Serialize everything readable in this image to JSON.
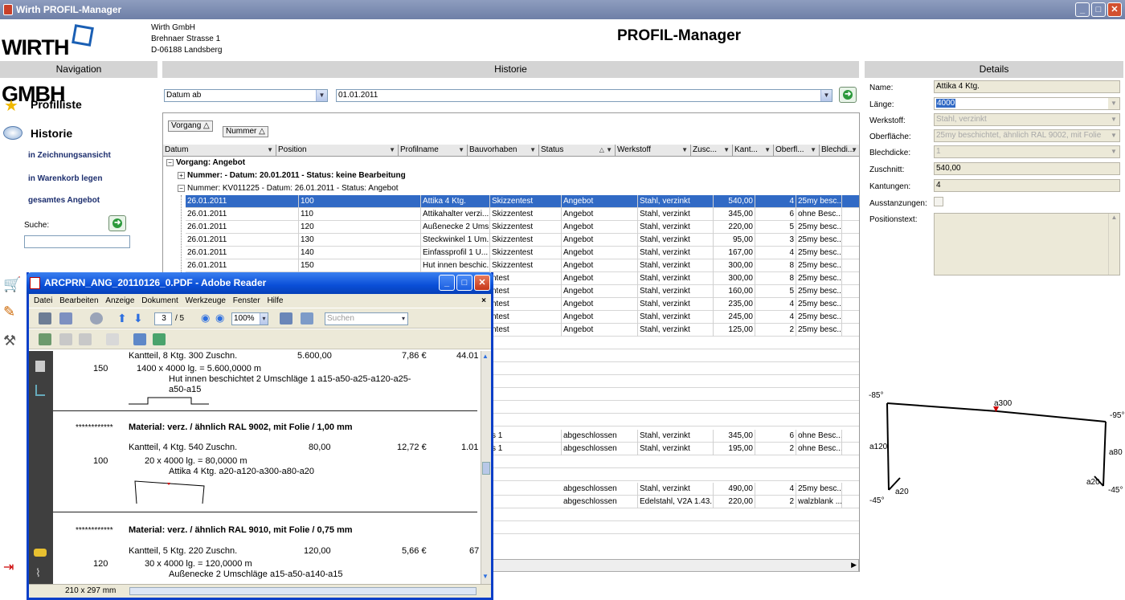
{
  "window": {
    "title": "Wirth PROFIL-Manager"
  },
  "header": {
    "logo_left": "WIRTH",
    "logo_right": "GMBH",
    "company_name": "Wirth GmbH",
    "street": "Brehnaer Strasse 1",
    "city": "D-06188 Landsberg",
    "app_title": "PROFIL-Manager"
  },
  "navigation": {
    "title": "Navigation",
    "profilliste": "Profilliste",
    "historie": "Historie",
    "zeichnung": "in Zeichnungsansicht",
    "warenkorb": "in Warenkorb legen",
    "angebot": "gesamtes Angebot",
    "suche_label": "Suche:",
    "suche_value": ""
  },
  "historie": {
    "title": "Historie",
    "filter_field": "Datum ab",
    "filter_date": "01.01.2011",
    "group_chips": [
      "Vorgang △",
      "Nummer △"
    ],
    "columns": [
      "Datum",
      "Position",
      "Profilname",
      "Bauvorhaben",
      "Status",
      "Werkstoff",
      "Zusc...",
      "Kant...",
      "Oberfl...",
      "Blechdi..."
    ],
    "group1": "Vorgang: Angebot",
    "sub1": "Nummer:  - Datum: 20.01.2011 - Status: keine Bearbeitung",
    "sub2": "Nummer: KV011225 - Datum: 26.01.2011 - Status: Angebot",
    "rows": [
      {
        "datum": "26.01.2011",
        "position": "100",
        "profil": "Attika 4 Ktg.",
        "bau": "Skizzentest",
        "status": "Angebot",
        "werk": "Stahl, verzinkt",
        "zus": "540,00",
        "kant": "4",
        "ober": "25my besc...",
        "blech": "1,0"
      },
      {
        "datum": "26.01.2011",
        "position": "110",
        "profil": "Attikahalter verzi...",
        "bau": "Skizzentest",
        "status": "Angebot",
        "werk": "Stahl, verzinkt",
        "zus": "345,00",
        "kant": "6",
        "ober": "ohne Besc...",
        "blech": "3,0"
      },
      {
        "datum": "26.01.2011",
        "position": "120",
        "profil": "Außenecke 2 Ums...",
        "bau": "Skizzentest",
        "status": "Angebot",
        "werk": "Stahl, verzinkt",
        "zus": "220,00",
        "kant": "5",
        "ober": "25my besc...",
        "blech": "0,7"
      },
      {
        "datum": "26.01.2011",
        "position": "130",
        "profil": "Steckwinkel 1 Um...",
        "bau": "Skizzentest",
        "status": "Angebot",
        "werk": "Stahl, verzinkt",
        "zus": "95,00",
        "kant": "3",
        "ober": "25my besc...",
        "blech": "0,7"
      },
      {
        "datum": "26.01.2011",
        "position": "140",
        "profil": "Einfassprofil 1 U...",
        "bau": "Skizzentest",
        "status": "Angebot",
        "werk": "Stahl, verzinkt",
        "zus": "167,00",
        "kant": "4",
        "ober": "25my besc...",
        "blech": "0,7"
      },
      {
        "datum": "26.01.2011",
        "position": "150",
        "profil": "Hut innen beschic...",
        "bau": "Skizzentest",
        "status": "Angebot",
        "werk": "Stahl, verzinkt",
        "zus": "300,00",
        "kant": "8",
        "ober": "25my besc...",
        "blech": "0,7"
      },
      {
        "datum": "",
        "position": "",
        "profil": "",
        "bau": "ntest",
        "status": "Angebot",
        "werk": "Stahl, verzinkt",
        "zus": "300,00",
        "kant": "8",
        "ober": "25my besc...",
        "blech": "0,7"
      },
      {
        "datum": "",
        "position": "",
        "profil": "",
        "bau": "ntest",
        "status": "Angebot",
        "werk": "Stahl, verzinkt",
        "zus": "160,00",
        "kant": "5",
        "ober": "25my besc...",
        "blech": "0,7"
      },
      {
        "datum": "",
        "position": "",
        "profil": "",
        "bau": "ntest",
        "status": "Angebot",
        "werk": "Stahl, verzinkt",
        "zus": "235,00",
        "kant": "4",
        "ober": "25my besc...",
        "blech": "0,7"
      },
      {
        "datum": "",
        "position": "",
        "profil": "",
        "bau": "ntest",
        "status": "Angebot",
        "werk": "Stahl, verzinkt",
        "zus": "245,00",
        "kant": "4",
        "ober": "25my besc...",
        "blech": "0,7"
      },
      {
        "datum": "",
        "position": "",
        "profil": "",
        "bau": "ntest",
        "status": "Angebot",
        "werk": "Stahl, verzinkt",
        "zus": "125,00",
        "kant": "2",
        "ober": "25my besc...",
        "blech": "1,0"
      }
    ],
    "rows2": [
      {
        "bau": "s 1",
        "status": "abgeschlossen",
        "werk": "Stahl, verzinkt",
        "zus": "345,00",
        "kant": "6",
        "ober": "ohne Besc...",
        "blech": "3,0"
      },
      {
        "bau": "s 1",
        "status": "abgeschlossen",
        "werk": "Stahl, verzinkt",
        "zus": "195,00",
        "kant": "2",
        "ober": "ohne Besc...",
        "blech": "3,0"
      }
    ],
    "rows3": [
      {
        "status": "abgeschlossen",
        "werk": "Stahl, verzinkt",
        "zus": "490,00",
        "kant": "4",
        "ober": "25my besc...",
        "blech": "0,7"
      },
      {
        "status": "abgeschlossen",
        "werk": "Edelstahl, V2A 1.43...",
        "zus": "220,00",
        "kant": "2",
        "ober": "walzblank ...",
        "blech": "1,0"
      }
    ]
  },
  "details": {
    "title": "Details",
    "name_label": "Name:",
    "name": "Attika 4 Ktg.",
    "laenge_label": "Länge:",
    "laenge": "4000",
    "werkstoff_label": "Werkstoff:",
    "werkstoff": "Stahl, verzinkt",
    "oberflaeche_label": "Oberfläche:",
    "oberflaeche": "25my beschichtet, ähnlich RAL 9002, mit Folie",
    "blechdicke_label": "Blechdicke:",
    "blechdicke": "1",
    "zuschnitt_label": "Zuschnitt:",
    "zuschnitt": "540,00",
    "kantungen_label": "Kantungen:",
    "kantungen": "4",
    "ausstanzungen_label": "Ausstanzungen:",
    "positionstext_label": "Positionstext:",
    "sketch": {
      "a_left": "-85°",
      "a_top": "a300",
      "a_right": "-95°",
      "l_left": "a120",
      "l_right": "a80",
      "b_left": "a20",
      "b_left_deg": "-45°",
      "b_right": "a20",
      "b_right_deg": "-45°"
    }
  },
  "pdf": {
    "title": "ARCPRN_ANG_20110126_0.PDF - Adobe Reader",
    "menu": [
      "Datei",
      "Bearbeiten",
      "Anzeige",
      "Dokument",
      "Werkzeuge",
      "Fenster",
      "Hilfe"
    ],
    "page": "3",
    "pages": "/ 5",
    "zoom": "100%",
    "search_placeholder": "Suchen",
    "status": "210 x 297 mm",
    "l1a": "Kantteil,  8 Ktg.  300 Zuschn.",
    "l1b": "5.600,00",
    "l1c": "7,86 €",
    "l1d": "44.01",
    "p150": "150",
    "l2": "1400 x     4000 lg. =       5.600,0000 m",
    "l3": "Hut innen beschichtet 2 Umschläge 1 a15-a50-a25-a120-a25-",
    "l4": "a50-a15",
    "stars1": "************",
    "mat1": "Material: verz. / ähnlich RAL 9002, mit Folie / 1,00 mm",
    "l5a": "Kantteil,  4 Ktg.  540 Zuschn.",
    "l5b": "80,00",
    "l5c": "12,72 €",
    "l5d": "1.01",
    "p100": "100",
    "l6": "20 x     4000 lg. =         80,0000 m",
    "l7": "Attika 4 Ktg. a20-a120-a300-a80-a20",
    "stars2": "************",
    "mat2": "Material: verz. / ähnlich RAL 9010, mit Folie / 0,75 mm",
    "l8a": "Kantteil,  5 Ktg.  220 Zuschn.",
    "l8b": "120,00",
    "l8c": "5,66 €",
    "l8d": "67",
    "p120": "120",
    "l9": "30 x     4000 lg. =       120,0000 m",
    "l10": "Außenecke 2 Umschläge a15-a50-a140-a15"
  }
}
